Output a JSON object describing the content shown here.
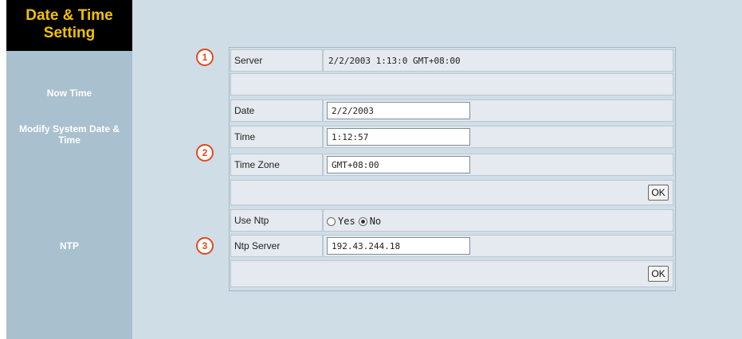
{
  "sidebar": {
    "title_line1": "Date & Time",
    "title_line2": "Setting",
    "items": [
      {
        "label": "Now Time"
      },
      {
        "label": "Modify System Date &"
      },
      {
        "label": "Time"
      },
      {
        "label": "NTP"
      }
    ]
  },
  "markers": [
    "1",
    "2",
    "3"
  ],
  "now_time": {
    "server_label": "Server",
    "server_value": "2/2/2003 1:13:0 GMT+08:00"
  },
  "modify": {
    "date_label": "Date",
    "date_value": "2/2/2003",
    "time_label": "Time",
    "time_value": "1:12:57",
    "timezone_label": "Time Zone",
    "timezone_value": "GMT+08:00",
    "ok_label": "OK"
  },
  "ntp": {
    "use_ntp_label": "Use Ntp",
    "yes_label": "Yes",
    "no_label": "No",
    "selected": "No",
    "server_label": "Ntp Server",
    "server_value": "192.43.244.18",
    "ok_label": "OK"
  },
  "colors": {
    "sidebar_bg": "#a9c0ce",
    "title_bg": "#000000",
    "title_text": "#f2c200",
    "marker": "#e34a1a",
    "main_bg": "#cfdde7"
  }
}
